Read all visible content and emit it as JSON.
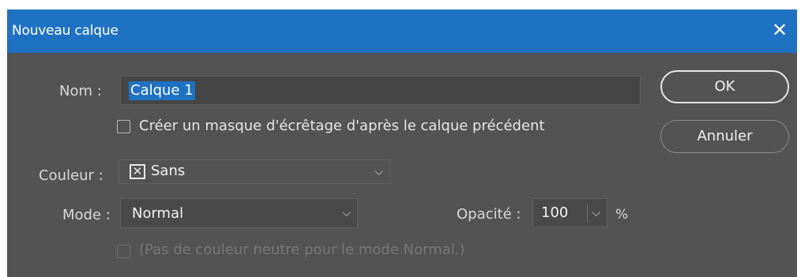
{
  "dialog": {
    "title": "Nouveau calque",
    "close_glyph": "✕"
  },
  "form": {
    "name_label": "Nom :",
    "name_value": "Calque 1",
    "clip_checkbox_label": "Créer un masque d'écrêtage d'après le calque précédent",
    "clip_checked": false,
    "color_label": "Couleur :",
    "color_value": "Sans",
    "color_icon": "x-box-icon",
    "mode_label": "Mode :",
    "mode_value": "Normal",
    "opacity_label": "Opacité :",
    "opacity_value": "100",
    "opacity_unit": "%",
    "neutral_checkbox_label": "(Pas de couleur neutre pour le mode Normal.)",
    "neutral_checked": false,
    "neutral_disabled": true
  },
  "buttons": {
    "ok_label": "OK",
    "cancel_label": "Annuler"
  },
  "colors": {
    "titlebar": "#1f72c2",
    "background": "#535353",
    "selection": "#1f72c2"
  }
}
